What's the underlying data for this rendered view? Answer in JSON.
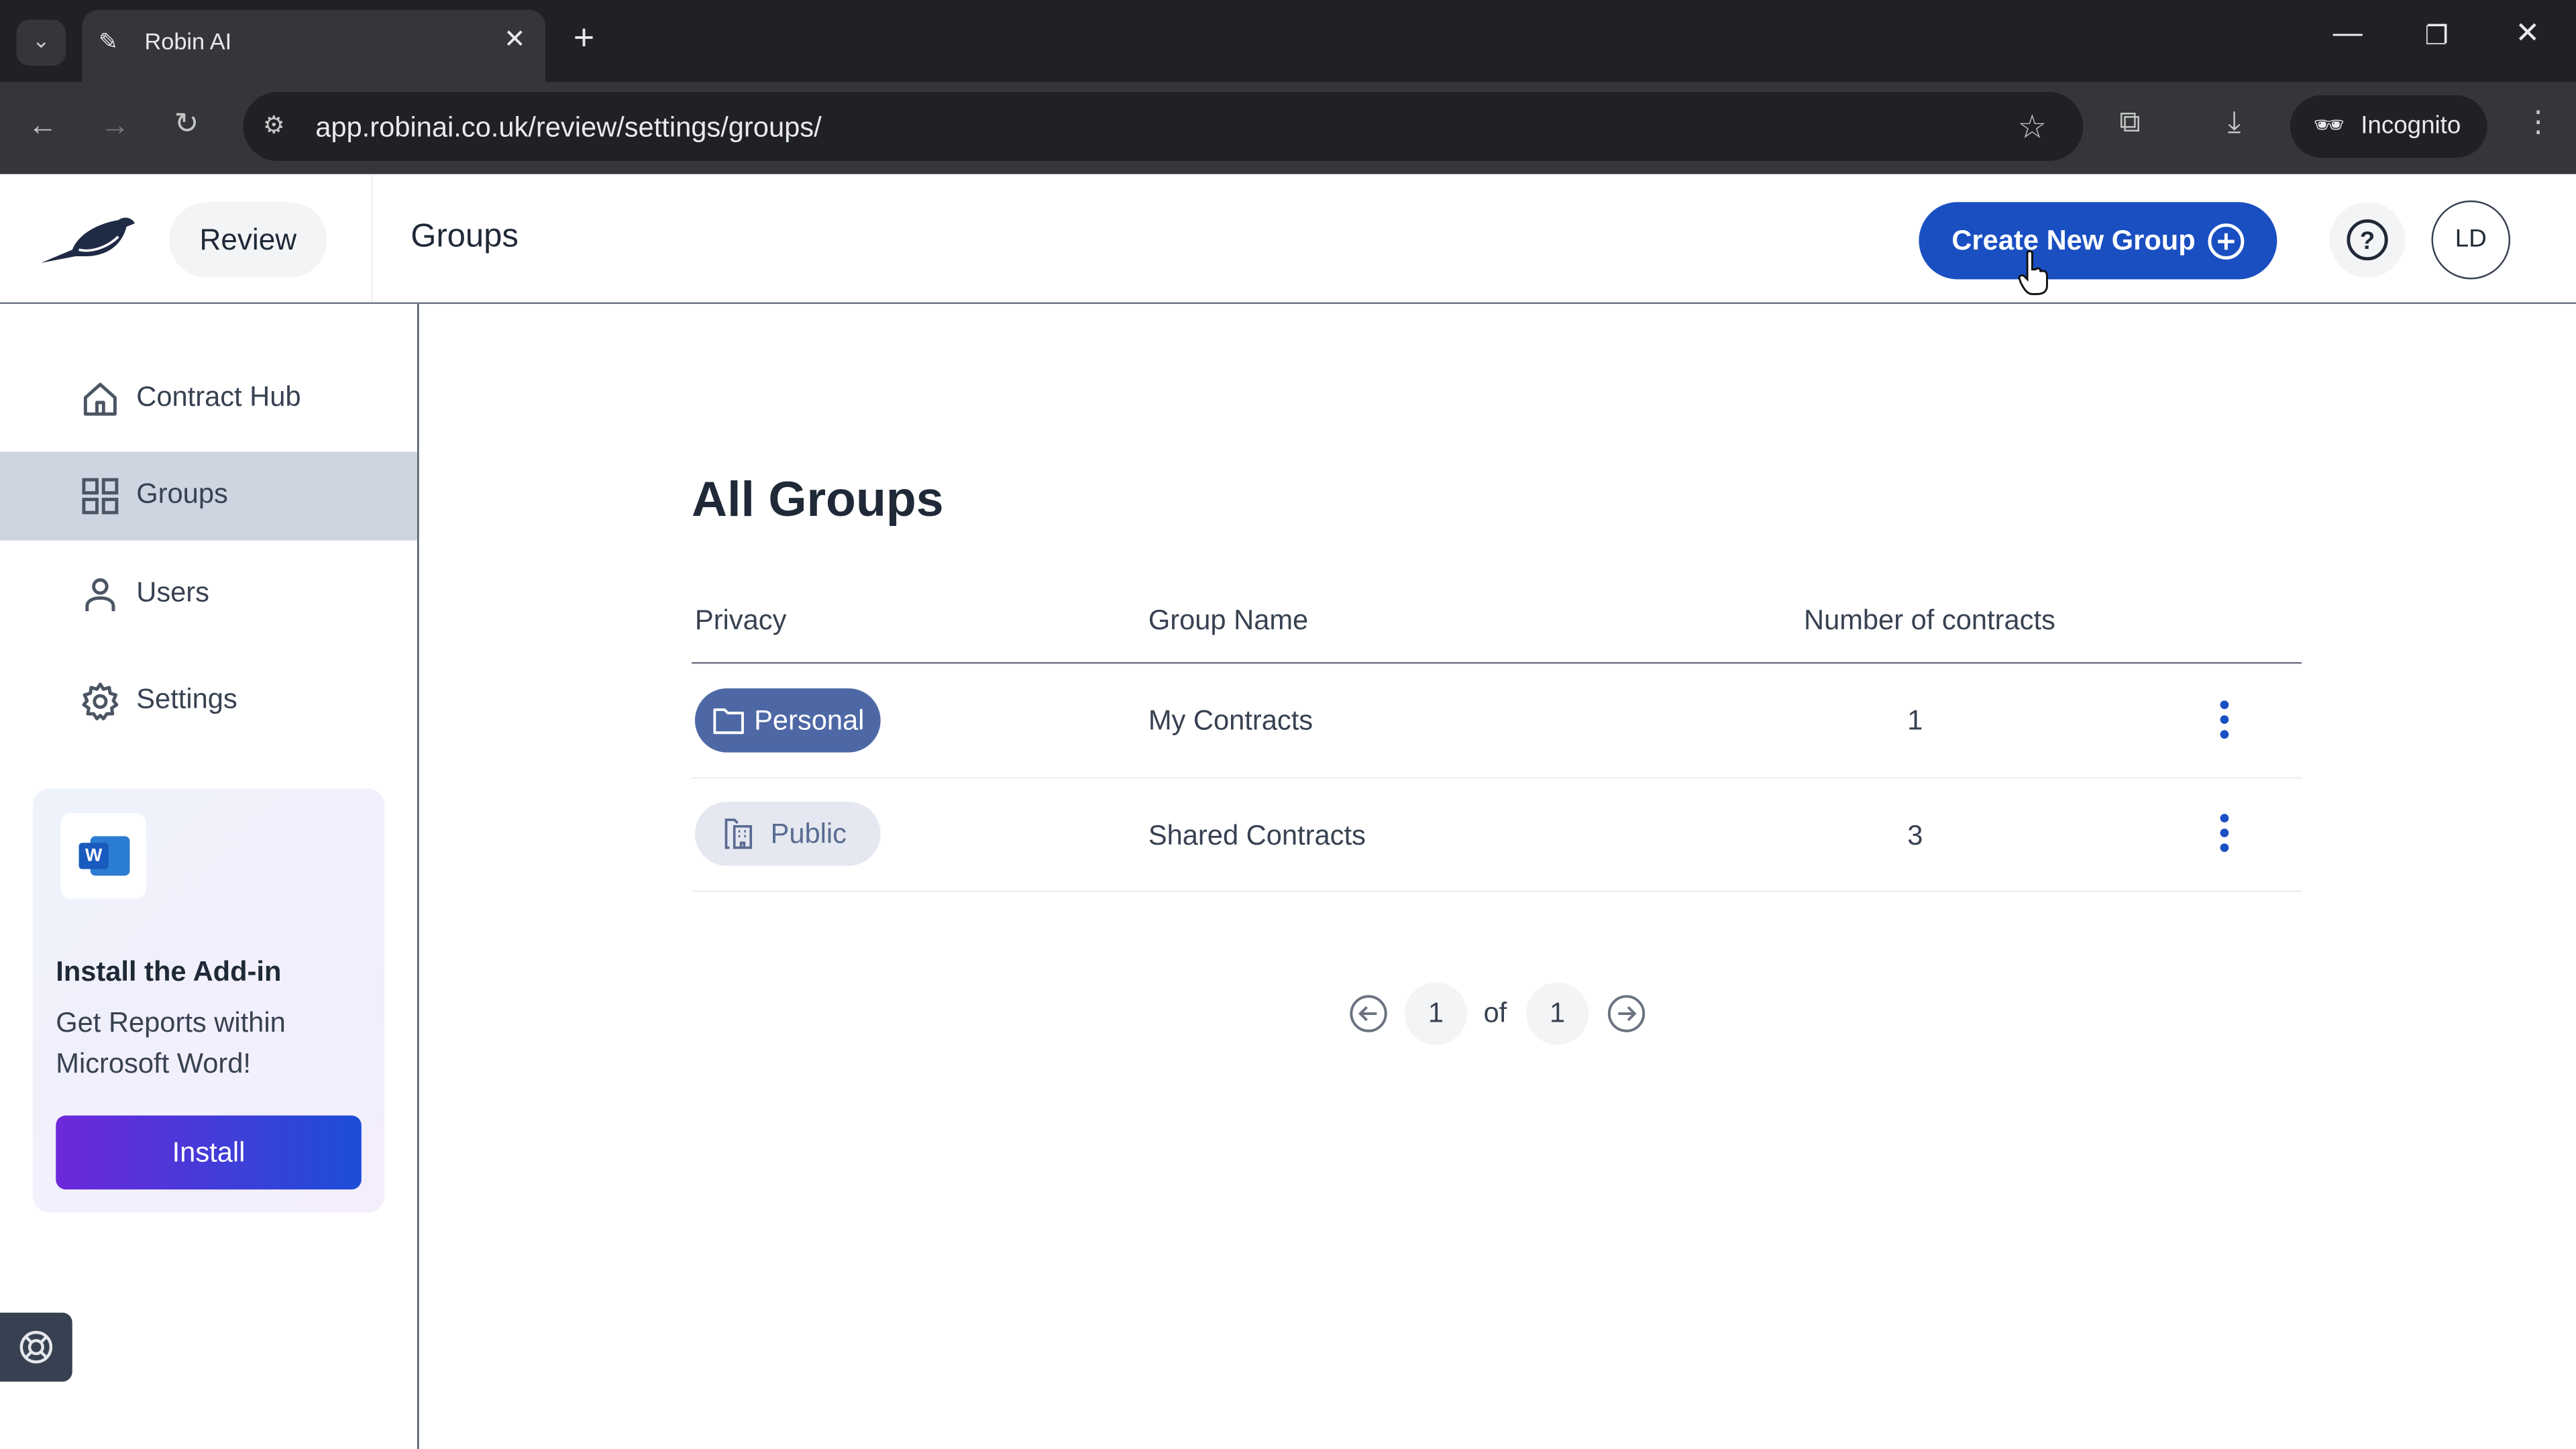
{
  "browser": {
    "tab_title": "Robin AI",
    "url": "app.robinai.co.uk/review/settings/groups/",
    "incognito_label": "Incognito"
  },
  "header": {
    "review_label": "Review",
    "page_title": "Groups",
    "create_button": "Create New Group",
    "avatar_initials": "LD"
  },
  "sidebar": {
    "items": [
      {
        "label": "Contract Hub",
        "icon": "home-icon"
      },
      {
        "label": "Groups",
        "icon": "grid-icon",
        "active": true
      },
      {
        "label": "Users",
        "icon": "user-icon"
      },
      {
        "label": "Settings",
        "icon": "gear-icon"
      }
    ],
    "addin": {
      "title": "Install the Add-in",
      "text": "Get Reports within Microsoft Word!",
      "button": "Install"
    }
  },
  "main": {
    "title": "All Groups",
    "columns": [
      "Privacy",
      "Group Name",
      "Number of contracts"
    ],
    "rows": [
      {
        "privacy": "Personal",
        "name": "My Contracts",
        "count": "1"
      },
      {
        "privacy": "Public",
        "name": "Shared Contracts",
        "count": "3"
      }
    ],
    "pagination": {
      "current": "1",
      "of_label": "of",
      "total": "1"
    }
  },
  "colors": {
    "primary": "#1a4fc2",
    "personal_pill": "#4e68a6",
    "public_pill": "#e5e8f0",
    "active_nav": "#cdd5e1"
  }
}
